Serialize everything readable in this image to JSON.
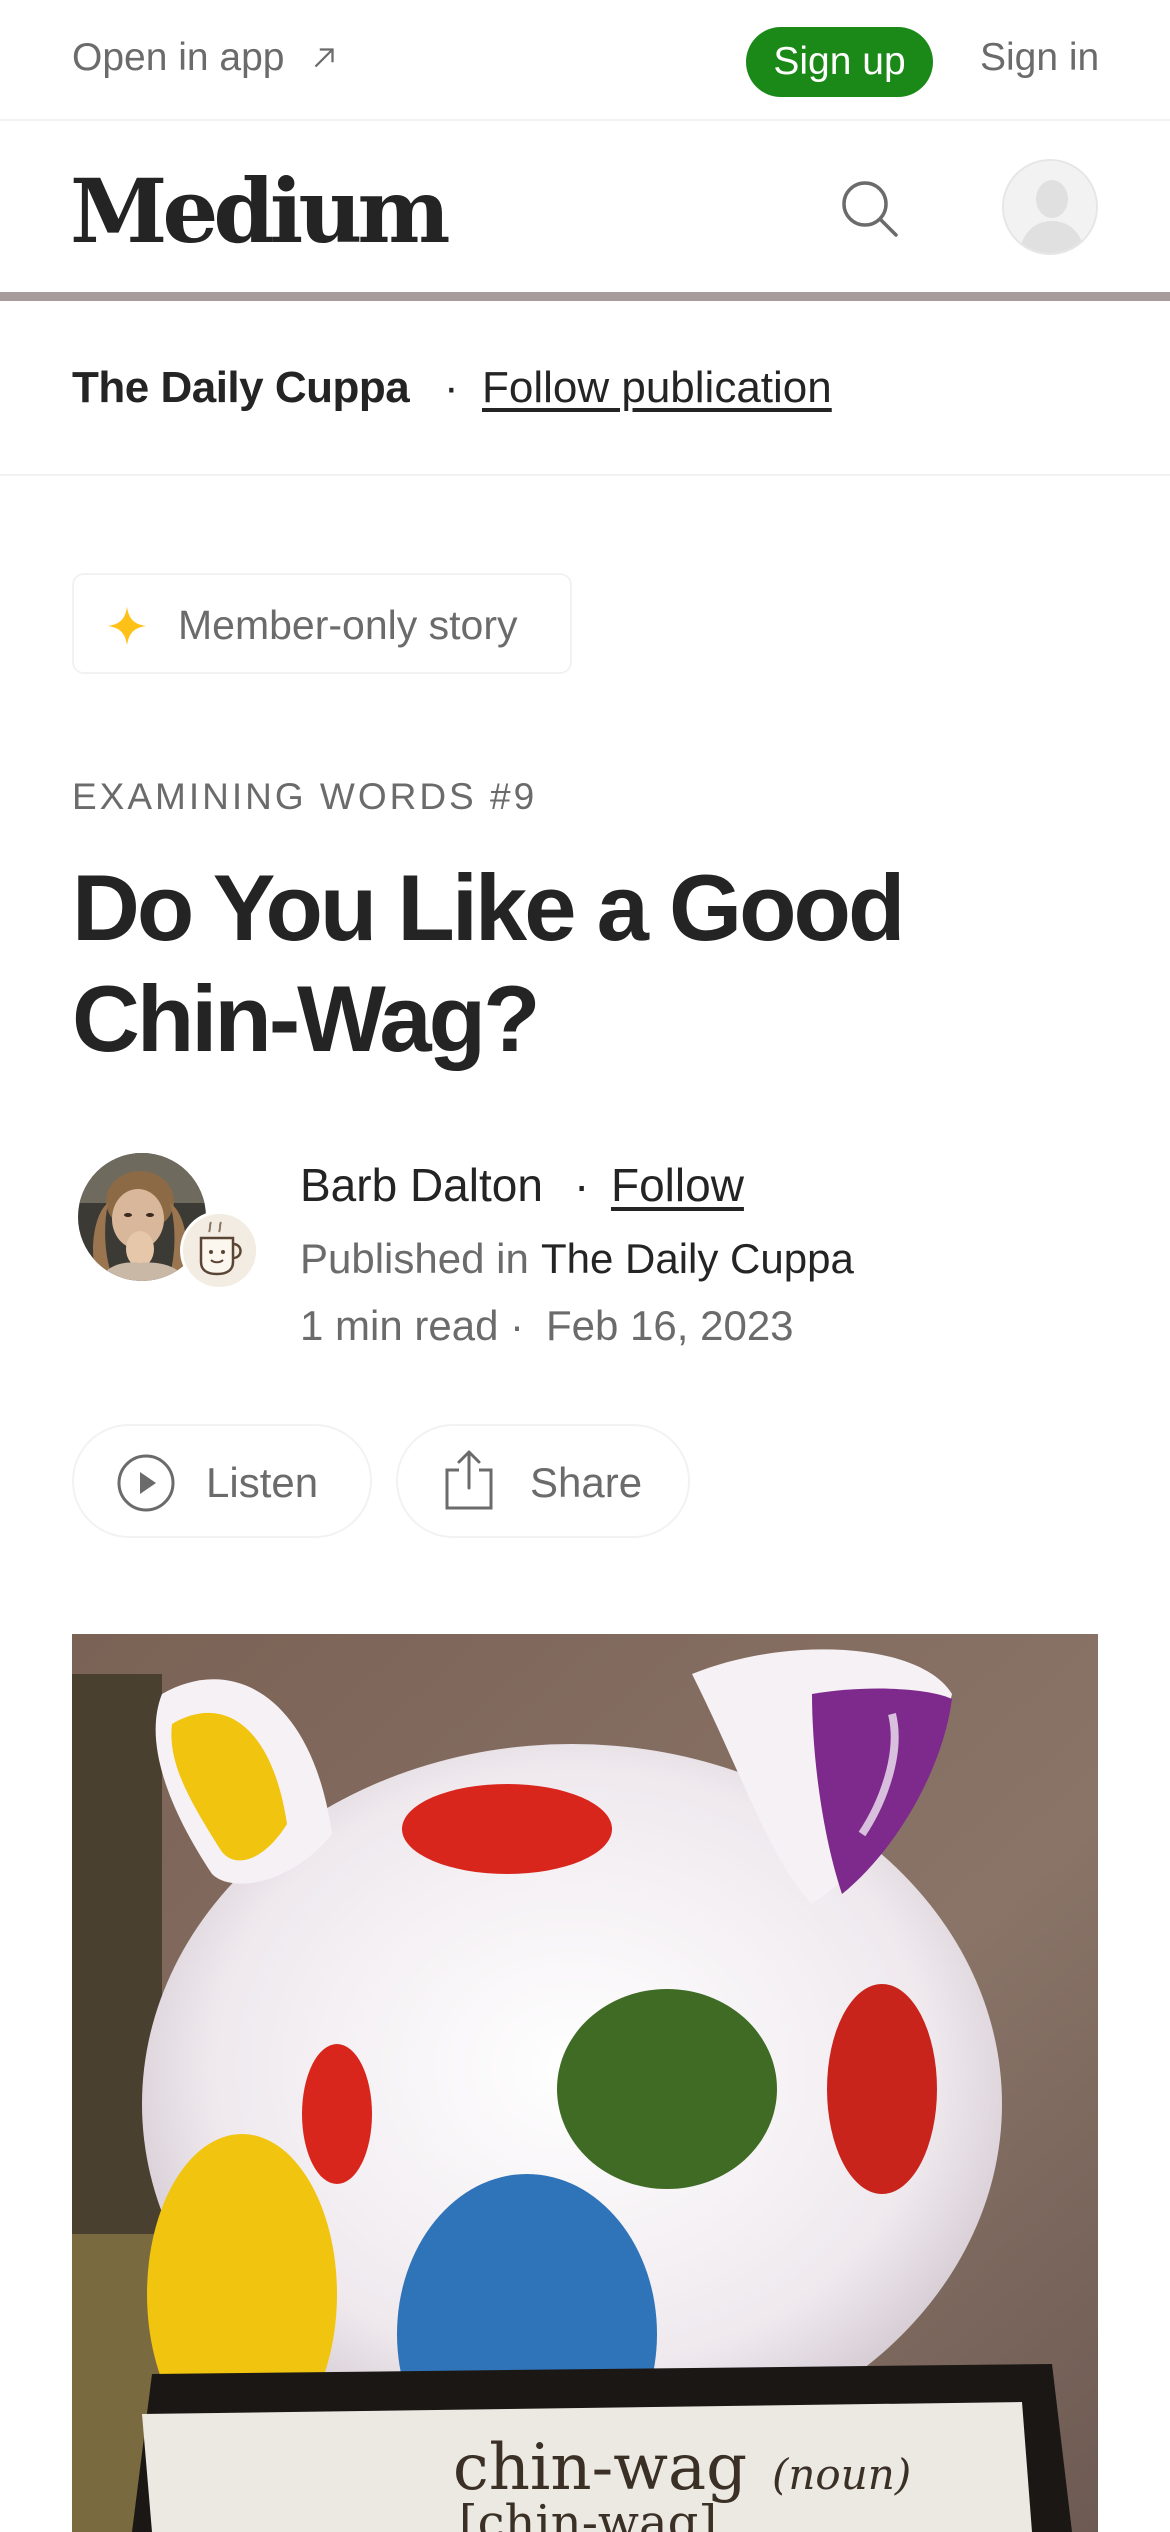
{
  "topbar": {
    "open_in_app": "Open in app",
    "sign_up": "Sign up",
    "sign_in": "Sign in"
  },
  "header": {
    "logo": "Medium"
  },
  "publication": {
    "name": "The Daily Cuppa",
    "separator": "·",
    "follow": "Follow publication"
  },
  "article": {
    "member_badge": "Member-only story",
    "kicker": "EXAMINING WORDS #9",
    "title": "Do You Like a Good Chin-Wag?",
    "author": {
      "name": "Barb Dalton",
      "separator": "·",
      "follow": "Follow",
      "published_in_label": "Published in",
      "published_in": "The Daily Cuppa",
      "read_time": "1 min read",
      "meta_separator": "·",
      "date": "Feb 16, 2023"
    },
    "actions": {
      "listen": "Listen",
      "share": "Share"
    },
    "hero_image": {
      "card_word": "chin-wag",
      "card_pos": "(noun)",
      "card_pronunciation": "[chin-wag]"
    }
  },
  "colors": {
    "accent_green": "#1a8917",
    "text_primary": "#242424",
    "text_secondary": "#6b6b6b",
    "star_yellow": "#ffc017"
  },
  "icons": [
    "arrow-up-right-icon",
    "search-icon",
    "user-avatar-icon",
    "star-icon",
    "play-circle-icon",
    "share-icon"
  ]
}
